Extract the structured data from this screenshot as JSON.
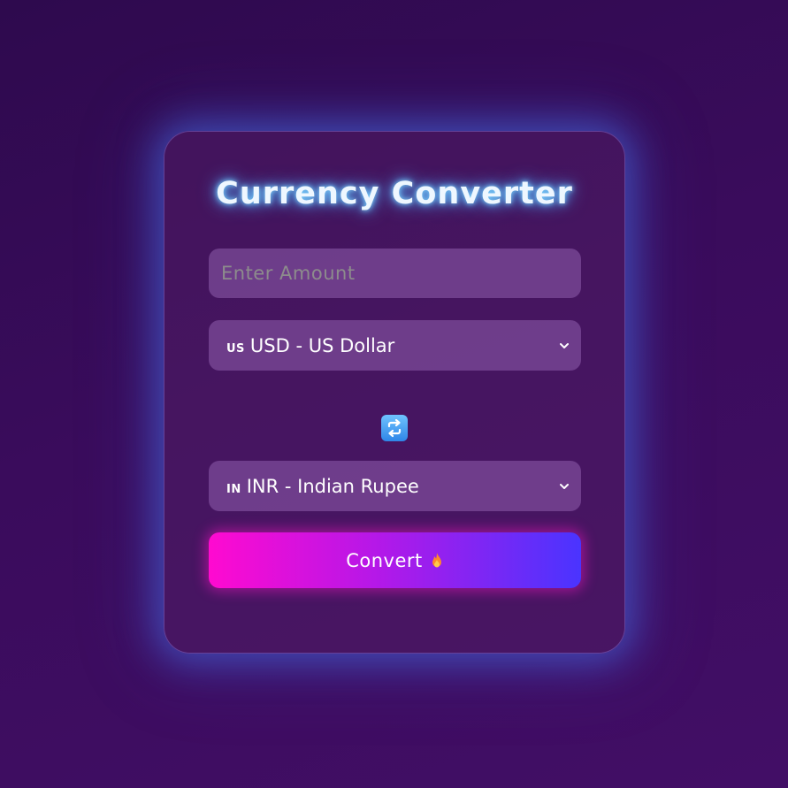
{
  "app": {
    "title": "Currency Converter"
  },
  "amount": {
    "placeholder": "Enter Amount",
    "value": ""
  },
  "from_currency": {
    "flag": "US",
    "selected": "USD - US Dollar"
  },
  "to_currency": {
    "flag": "IN",
    "selected": "INR - Indian Rupee"
  },
  "swap": {
    "icon": "swap-icon"
  },
  "convert": {
    "label": "Convert",
    "icon": "fire-icon"
  },
  "colors": {
    "title_glow": "#5ab8ff",
    "button_start": "#ff0ad0",
    "button_end": "#4a34ff",
    "card_glow": "#4670e6"
  }
}
